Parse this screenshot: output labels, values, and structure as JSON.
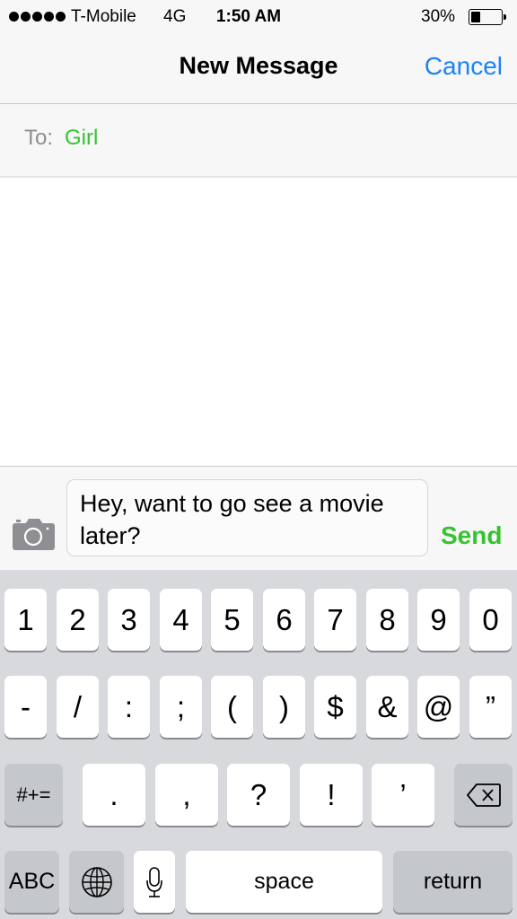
{
  "status_bar": {
    "signal_dots": 5,
    "carrier": "T-Mobile",
    "network": "4G",
    "time": "1:50 AM",
    "battery_percent_label": "30%",
    "battery_level": 0.3
  },
  "nav": {
    "title": "New Message",
    "cancel_label": "Cancel"
  },
  "recipient": {
    "label": "To:",
    "name": "Girl"
  },
  "compose": {
    "camera_icon": "camera-icon",
    "message_text": "Hey, want to go see a movie later?",
    "send_label": "Send"
  },
  "keyboard": {
    "row1": [
      "1",
      "2",
      "3",
      "4",
      "5",
      "6",
      "7",
      "8",
      "9",
      "0"
    ],
    "row2": [
      "-",
      "/",
      ":",
      ";",
      "(",
      ")",
      "$",
      "&",
      "@",
      "”"
    ],
    "row3": {
      "symbols_label": "#+=",
      "keys": [
        ".",
        ",",
        "?",
        "!",
        "’"
      ],
      "delete_icon": "backspace-icon"
    },
    "row4": {
      "abc_label": "ABC",
      "globe_icon": "globe-icon",
      "mic_icon": "microphone-icon",
      "space_label": "space",
      "return_label": "return"
    }
  },
  "colors": {
    "accent_blue": "#1a82fb",
    "accent_green": "#35c430",
    "bar_background": "#f7f7f7",
    "keyboard_background": "#d7d9dd"
  }
}
